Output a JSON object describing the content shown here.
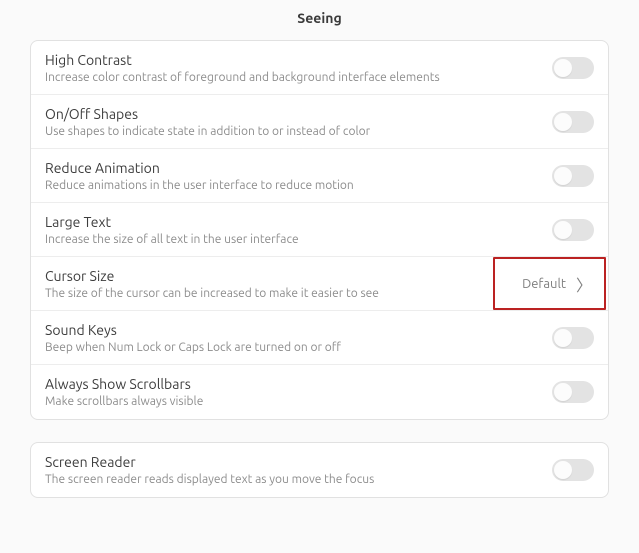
{
  "heading": "Seeing",
  "group1": [
    {
      "title": "High Contrast",
      "subtitle": "Increase color contrast of foreground and background interface elements",
      "type": "switch"
    },
    {
      "title": "On/Off Shapes",
      "subtitle": "Use shapes to indicate state in addition to or instead of color",
      "type": "switch"
    },
    {
      "title": "Reduce Animation",
      "subtitle": "Reduce animations in the user interface to reduce motion",
      "type": "switch"
    },
    {
      "title": "Large Text",
      "subtitle": "Increase the size of all text in the user interface",
      "type": "switch"
    },
    {
      "title": "Cursor Size",
      "subtitle": "The size of the cursor can be increased to make it easier to see",
      "type": "link",
      "value": "Default",
      "highlighted": true
    },
    {
      "title": "Sound Keys",
      "subtitle": "Beep when Num Lock or Caps Lock are turned on or off",
      "type": "switch"
    },
    {
      "title": "Always Show Scrollbars",
      "subtitle": "Make scrollbars always visible",
      "type": "switch"
    }
  ],
  "group2": [
    {
      "title": "Screen Reader",
      "subtitle": "The screen reader reads displayed text as you move the focus",
      "type": "switch"
    }
  ]
}
